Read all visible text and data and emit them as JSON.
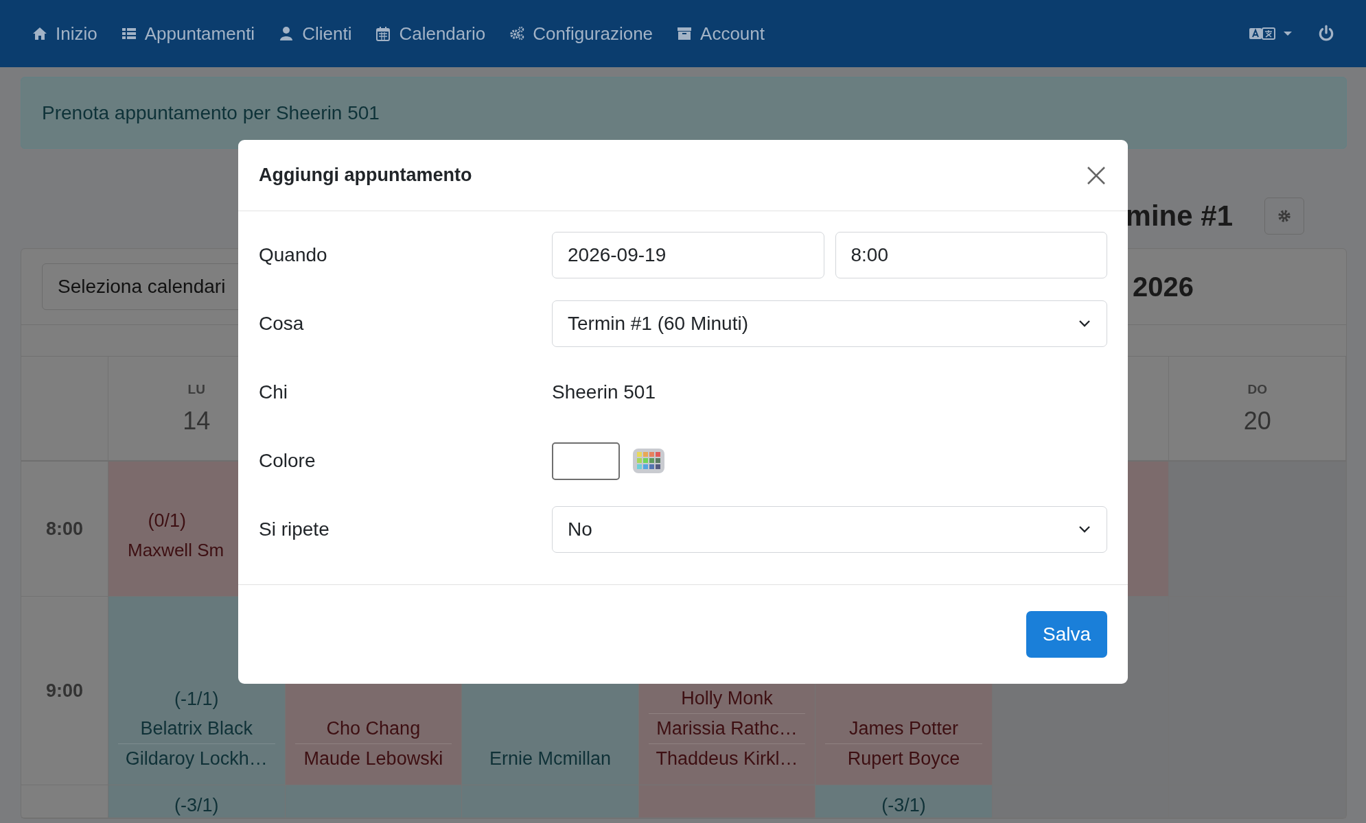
{
  "navbar": {
    "items": [
      {
        "label": "Inizio"
      },
      {
        "label": "Appuntamenti"
      },
      {
        "label": "Clienti"
      },
      {
        "label": "Calendario"
      },
      {
        "label": "Configurazione"
      },
      {
        "label": "Account"
      }
    ]
  },
  "notice": "Prenota appuntamento per Sheerin 501",
  "page_heading": "mine #1",
  "calendar": {
    "selector": "Seleziona calendari",
    "period": "2026",
    "days": [
      {
        "weekday": "LU",
        "date": "14"
      },
      {
        "weekday": "DO",
        "date": "20"
      }
    ],
    "rows": [
      {
        "time": "8:00",
        "cells": [
          {
            "kind": "full",
            "capacity": "(0/1)",
            "names": [
              "Maxwell Sm"
            ]
          },
          {},
          {},
          {},
          {},
          {
            "kind": "full"
          },
          {
            "kind": "closed"
          }
        ]
      },
      {
        "time": "9:00",
        "cells": [
          {
            "kind": "open",
            "capacity": "(-1/1)",
            "names": [
              "Belatrix Black",
              "Gildaroy Lockh…"
            ]
          },
          {
            "kind": "full",
            "names": [
              "Cho Chang",
              "Maude Lebowski"
            ]
          },
          {
            "kind": "open",
            "names": [
              "Ernie Mcmillan"
            ]
          },
          {
            "kind": "full",
            "names": [
              "Holly Monk",
              "Marissia Rathc…",
              "Thaddeus Kirkl…"
            ]
          },
          {
            "kind": "full",
            "names": [
              "James Potter",
              "Rupert Boyce"
            ]
          },
          {
            "kind": "closed"
          },
          {
            "kind": "closed"
          }
        ]
      },
      {
        "cells": [
          {
            "kind": "open",
            "capacity": "(-3/1)"
          },
          {
            "kind": "open"
          },
          {
            "kind": "open"
          },
          {
            "kind": "full"
          },
          {
            "kind": "open",
            "capacity": "(-3/1)"
          },
          {
            "kind": "closed"
          },
          {
            "kind": "closed"
          }
        ]
      }
    ]
  },
  "modal": {
    "title": "Aggiungi appuntamento",
    "fields": [
      {
        "kind": "datetime",
        "label": "Quando",
        "date": "2026-09-19",
        "time": "8:00"
      },
      {
        "kind": "select",
        "label": "Cosa",
        "value": "Termin #1 (60 Minuti)"
      },
      {
        "kind": "text",
        "label": "Chi",
        "value": "Sheerin 501"
      },
      {
        "kind": "color",
        "label": "Colore"
      },
      {
        "kind": "select",
        "label": "Si ripete",
        "value": "No"
      }
    ],
    "buttons": [
      {
        "label": "Salva"
      }
    ]
  }
}
